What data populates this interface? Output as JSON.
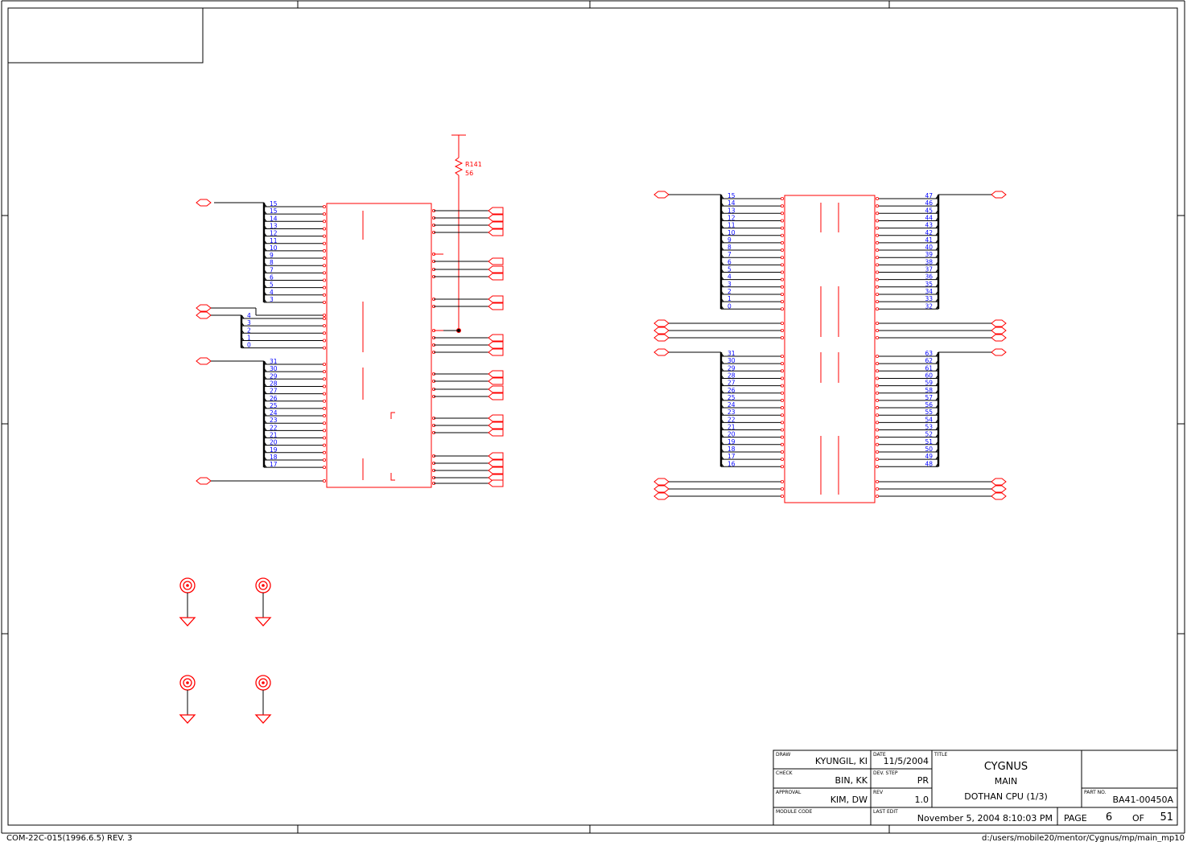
{
  "resistor": {
    "ref": "R141",
    "value": "56"
  },
  "left_part": {
    "bus_a": [
      "15",
      "15",
      "14",
      "13",
      "12",
      "11",
      "10",
      "9",
      "8",
      "7",
      "6",
      "5",
      "4",
      "3"
    ],
    "bus_b": [
      "4",
      "3",
      "2",
      "1",
      "0"
    ],
    "bus_c": [
      "31",
      "30",
      "29",
      "28",
      "27",
      "26",
      "25",
      "24",
      "23",
      "22",
      "21",
      "20",
      "19",
      "18",
      "17"
    ]
  },
  "right_part": {
    "left_top": [
      "15",
      "14",
      "13",
      "12",
      "11",
      "10",
      "9",
      "8",
      "7",
      "6",
      "5",
      "4",
      "3",
      "2",
      "1",
      "0"
    ],
    "right_top": [
      "47",
      "46",
      "45",
      "44",
      "43",
      "42",
      "41",
      "40",
      "39",
      "38",
      "37",
      "36",
      "35",
      "34",
      "33",
      "32"
    ],
    "left_bottom": [
      "31",
      "30",
      "29",
      "28",
      "27",
      "26",
      "25",
      "24",
      "23",
      "22",
      "21",
      "20",
      "19",
      "18",
      "17",
      "16"
    ],
    "right_bottom": [
      "63",
      "62",
      "61",
      "60",
      "59",
      "58",
      "57",
      "56",
      "55",
      "54",
      "53",
      "52",
      "51",
      "50",
      "49",
      "48"
    ]
  },
  "title_block": {
    "draw_label": "DRAW",
    "draw_value": "KYUNGIL, KI",
    "check_label": "CHECK",
    "check_value": "BIN, KK",
    "approval_label": "APPROVAL",
    "approval_value": "KIM, DW",
    "module_label": "MODULE CODE",
    "module_value": "",
    "date_label": "DATE",
    "date_value": "11/5/2004",
    "devstep_label": "DEV. STEP",
    "devstep_value": "PR",
    "rev_label": "REV",
    "rev_value": "1.0",
    "lastedit_label": "LAST EDIT",
    "lastedit_value": "November 5, 2004  8:10:03 PM",
    "title_label": "TITLE",
    "title_line1": "CYGNUS",
    "title_line2": "MAIN",
    "title_line3": "DOTHAN CPU (1/3)",
    "partno_label": "PART NO.",
    "partno_value": "BA41-00450A",
    "page_label": "PAGE",
    "page_value": "6",
    "of_label": "OF",
    "of_value": "51"
  },
  "footer": {
    "form_code": "COM-22C-015(1996.6.5) REV. 3",
    "path": "d:/users/mobile20/mentor/Cygnus/mp/main_mp10"
  },
  "colors": {
    "part": "#ff0000",
    "wire": "#000000",
    "pin_label": "#0000ff",
    "frame": "#000000"
  }
}
